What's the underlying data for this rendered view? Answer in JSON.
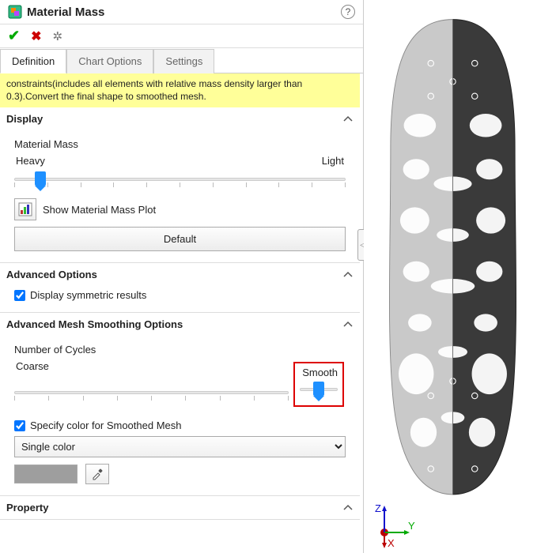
{
  "header": {
    "title": "Material Mass"
  },
  "tabs": {
    "definition": "Definition",
    "chart": "Chart Options",
    "settings": "Settings"
  },
  "note": "constraints(includes all elements with relative mass density larger than 0.3).Convert the final shape to smoothed mesh.",
  "display": {
    "title": "Display",
    "subtitle": "Material Mass",
    "heavy": "Heavy",
    "light": "Light",
    "showplot": "Show Material Mass Plot",
    "default": "Default"
  },
  "adv": {
    "title": "Advanced Options",
    "sym": "Display symmetric results"
  },
  "mesh": {
    "title": "Advanced Mesh Smoothing Options",
    "cycles": "Number of Cycles",
    "coarse": "Coarse",
    "smooth": "Smooth",
    "specify": "Specify color for Smoothed Mesh",
    "colormode": "Single color"
  },
  "property": {
    "title": "Property"
  },
  "triad": {
    "z": "Z",
    "y": "Y",
    "x": "X"
  }
}
